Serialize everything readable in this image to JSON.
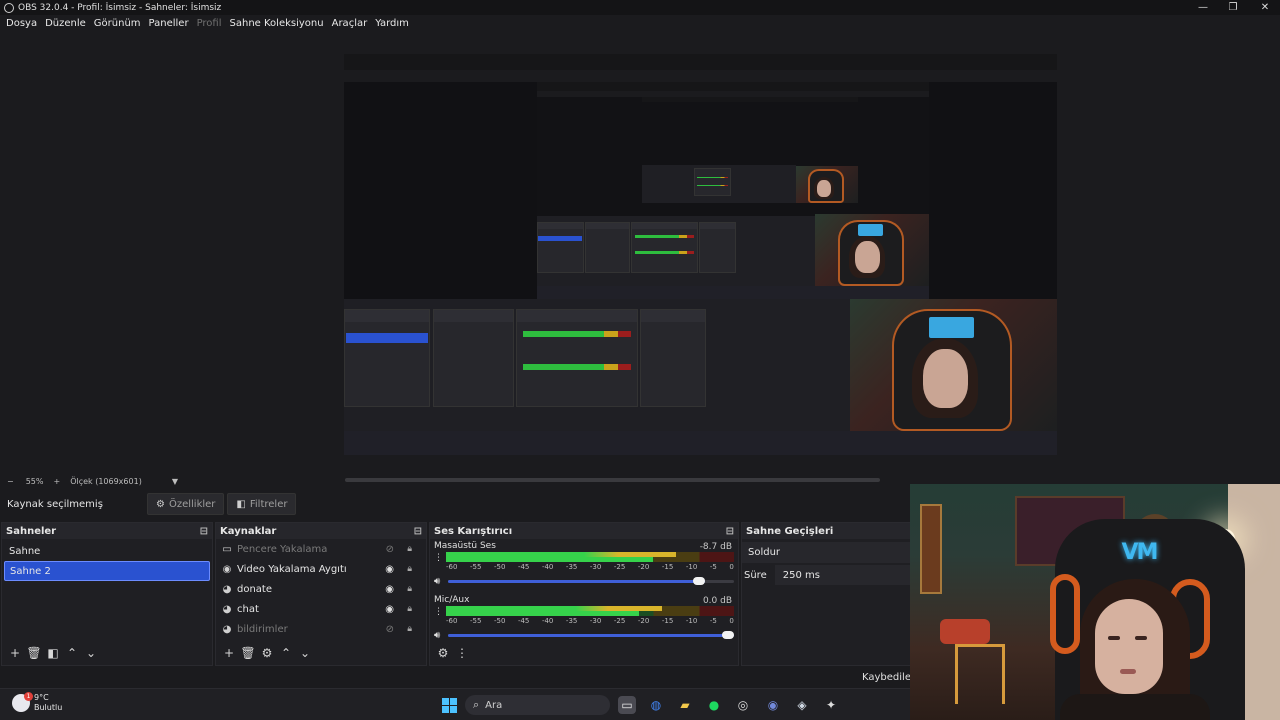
{
  "window": {
    "title": "OBS 32.0.4 - Profil: İsimsiz - Sahneler: İsimsiz"
  },
  "menu": [
    {
      "label": "Dosya",
      "disabled": false
    },
    {
      "label": "Düzenle",
      "disabled": false
    },
    {
      "label": "Görünüm",
      "disabled": false
    },
    {
      "label": "Paneller",
      "disabled": false
    },
    {
      "label": "Profil",
      "disabled": true
    },
    {
      "label": "Sahne Koleksiyonu",
      "disabled": false
    },
    {
      "label": "Araçlar",
      "disabled": false
    },
    {
      "label": "Yardım",
      "disabled": false
    }
  ],
  "zoom": {
    "minus": "−",
    "level": "55%",
    "plus": "+",
    "scale": "Ölçek (1069x601)"
  },
  "context": {
    "label": "Kaynak seçilmemiş",
    "properties": "Özellikler",
    "filters": "Filtreler"
  },
  "scenes": {
    "title": "Sahneler",
    "items": [
      {
        "label": "Sahne",
        "selected": false
      },
      {
        "label": "Sahne 2",
        "selected": true
      }
    ]
  },
  "sources": {
    "title": "Kaynaklar",
    "items": [
      {
        "label": "Pencere Yakalama",
        "icon": "window-icon",
        "visible": false
      },
      {
        "label": "Video Yakalama Aygıtı",
        "icon": "camera-icon",
        "visible": true
      },
      {
        "label": "donate",
        "icon": "browser-icon",
        "visible": true
      },
      {
        "label": "chat",
        "icon": "browser-icon",
        "visible": true
      },
      {
        "label": "bildirimler",
        "icon": "browser-icon",
        "visible": false
      }
    ]
  },
  "mixer": {
    "title": "Ses Karıştırıcı",
    "ticks": [
      "-60",
      "-55",
      "-50",
      "-45",
      "-40",
      "-35",
      "-30",
      "-25",
      "-20",
      "-15",
      "-10",
      "-5",
      "0"
    ],
    "channels": [
      {
        "name": "Masaüstü Ses",
        "db": "-8.7 dB",
        "level": 0.8,
        "volume": 0.9
      },
      {
        "name": "Mic/Aux",
        "db": "0.0 dB",
        "level": 0.75,
        "volume": 1.0
      }
    ]
  },
  "transitions": {
    "title": "Sahne Geçişleri",
    "type": "Soldur",
    "duration_label": "Süre",
    "duration_value": "250 ms"
  },
  "status": {
    "text": "Kaybedilen k"
  },
  "taskbar": {
    "weather_temp": "9°C",
    "weather_desc": "Bulutlu",
    "weather_badge": "1",
    "search_placeholder": "Ara"
  },
  "colors": {
    "accent": "#2a52d0",
    "background": "#1b1b1e",
    "meter_green": "#36d24b",
    "meter_yellow": "#d9b52b",
    "meter_red": "#9b1d1d"
  }
}
